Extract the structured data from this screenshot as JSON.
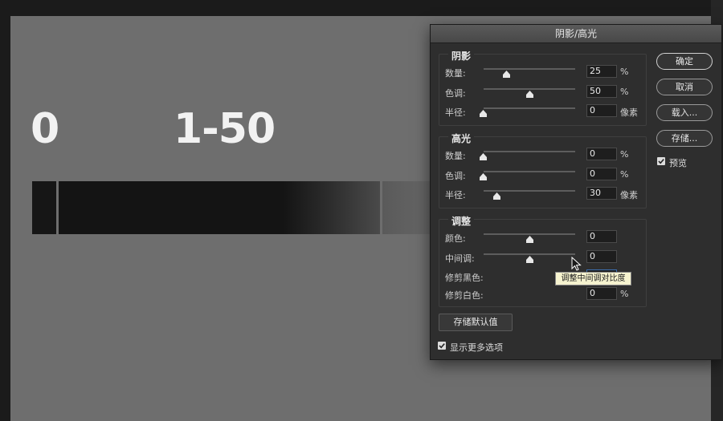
{
  "canvas": {
    "label_zero": "0",
    "label_range": "1-50"
  },
  "dialog": {
    "title": "阴影/高光",
    "shadows": {
      "title": "阴影",
      "amount_label": "数量:",
      "amount_value": "25",
      "amount_unit": "%",
      "tone_label": "色调:",
      "tone_value": "50",
      "tone_unit": "%",
      "radius_label": "半径:",
      "radius_value": "0",
      "radius_unit": "像素"
    },
    "highlights": {
      "title": "高光",
      "amount_label": "数量:",
      "amount_value": "0",
      "amount_unit": "%",
      "tone_label": "色调:",
      "tone_value": "0",
      "tone_unit": "%",
      "radius_label": "半径:",
      "radius_value": "30",
      "radius_unit": "像素"
    },
    "adjustments": {
      "title": "调整",
      "color_label": "颜色:",
      "color_value": "0",
      "midtone_label": "中间调:",
      "midtone_value": "0",
      "black_clip_label": "修剪黑色:",
      "black_clip_value": "",
      "white_clip_label": "修剪白色:",
      "white_clip_value": "0",
      "white_clip_unit": "%"
    },
    "buttons": {
      "ok": "确定",
      "cancel": "取消",
      "load": "载入...",
      "save": "存储...",
      "save_defaults": "存储默认值"
    },
    "preview_label": "预览",
    "preview_checked": true,
    "show_more_label": "显示更多选项",
    "show_more_checked": true,
    "tooltip": "调整中间调对比度"
  }
}
